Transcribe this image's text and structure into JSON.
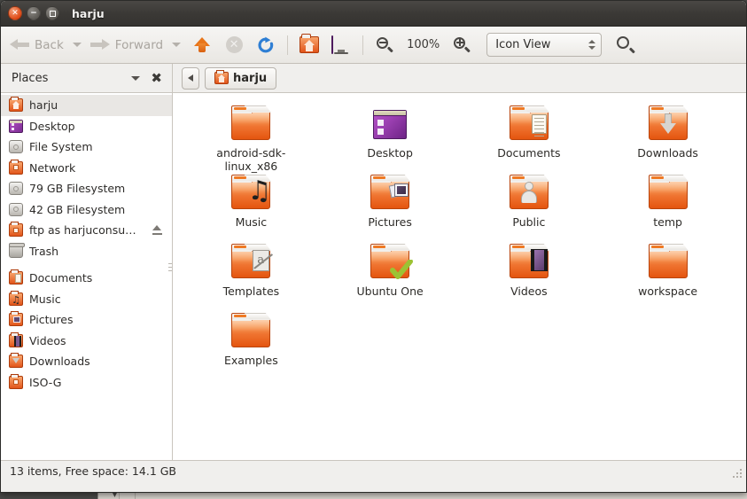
{
  "window": {
    "title": "harju",
    "controls": [
      {
        "name": "close",
        "glyph": "✕"
      },
      {
        "name": "minimize",
        "glyph": "−"
      },
      {
        "name": "maximize",
        "glyph": ""
      }
    ]
  },
  "toolbar": {
    "back_label": "Back",
    "forward_label": "Forward",
    "up_tooltip": "Up",
    "stop_glyph": "✕",
    "zoom_level": "100%",
    "view_mode": "Icon View",
    "icons": [
      "back-arrow-icon",
      "forward-arrow-icon",
      "up-arrow-icon",
      "stop-icon",
      "reload-icon",
      "home-icon",
      "computer-icon",
      "zoom-out-icon",
      "zoom-in-icon",
      "search-icon"
    ]
  },
  "places_pane": {
    "title": "Places",
    "close_glyph": "✖",
    "items": [
      {
        "label": "harju",
        "icon": "folder-home",
        "selected": true,
        "eject": false
      },
      {
        "label": "Desktop",
        "icon": "monitor",
        "selected": false,
        "eject": false
      },
      {
        "label": "File System",
        "icon": "drive",
        "selected": false,
        "eject": false
      },
      {
        "label": "Network",
        "icon": "folder-plain",
        "selected": false,
        "eject": false
      },
      {
        "label": "79 GB Filesystem",
        "icon": "drive",
        "selected": false,
        "eject": false
      },
      {
        "label": "42 GB Filesystem",
        "icon": "drive",
        "selected": false,
        "eject": false
      },
      {
        "label": "ftp as harjuconsu…",
        "icon": "folder-plain",
        "selected": false,
        "eject": true
      },
      {
        "label": "Trash",
        "icon": "trash",
        "selected": false,
        "eject": false
      },
      {
        "label": "__SEPARATOR__",
        "icon": "",
        "selected": false,
        "eject": false
      },
      {
        "label": "Documents",
        "icon": "docs",
        "selected": false,
        "eject": false
      },
      {
        "label": "Music",
        "icon": "music-f",
        "selected": false,
        "eject": false
      },
      {
        "label": "Pictures",
        "icon": "pic-f",
        "selected": false,
        "eject": false
      },
      {
        "label": "Videos",
        "icon": "video-f",
        "selected": false,
        "eject": false
      },
      {
        "label": "Downloads",
        "icon": "dl-f",
        "selected": false,
        "eject": false
      },
      {
        "label": "ISO-G",
        "icon": "folder-plain",
        "selected": false,
        "eject": false
      }
    ]
  },
  "pathbar": {
    "prev_glyph": "◀",
    "current": "harju"
  },
  "files": [
    {
      "name": "android-sdk-linux_x86",
      "kind": "folder-plain"
    },
    {
      "name": "Desktop",
      "kind": "folder-desktop"
    },
    {
      "name": "Documents",
      "kind": "folder-documents"
    },
    {
      "name": "Downloads",
      "kind": "folder-downloads"
    },
    {
      "name": "Music",
      "kind": "folder-music"
    },
    {
      "name": "Pictures",
      "kind": "folder-pictures"
    },
    {
      "name": "Public",
      "kind": "folder-public"
    },
    {
      "name": "temp",
      "kind": "folder-plain"
    },
    {
      "name": "Templates",
      "kind": "folder-templates"
    },
    {
      "name": "Ubuntu One",
      "kind": "folder-ubuntuone"
    },
    {
      "name": "Videos",
      "kind": "folder-videos"
    },
    {
      "name": "workspace",
      "kind": "folder-plain"
    },
    {
      "name": "Examples",
      "kind": "folder-plain"
    }
  ],
  "statusbar": {
    "text": "13 items, Free space: 14.1 GB"
  },
  "colors": {
    "folder_orange": "#e4550f",
    "titlebar_dark": "#3b3936",
    "accent_purple": "#7c2d93",
    "window_bg": "#f0efed",
    "selection_grey": "#e9e7e4"
  }
}
